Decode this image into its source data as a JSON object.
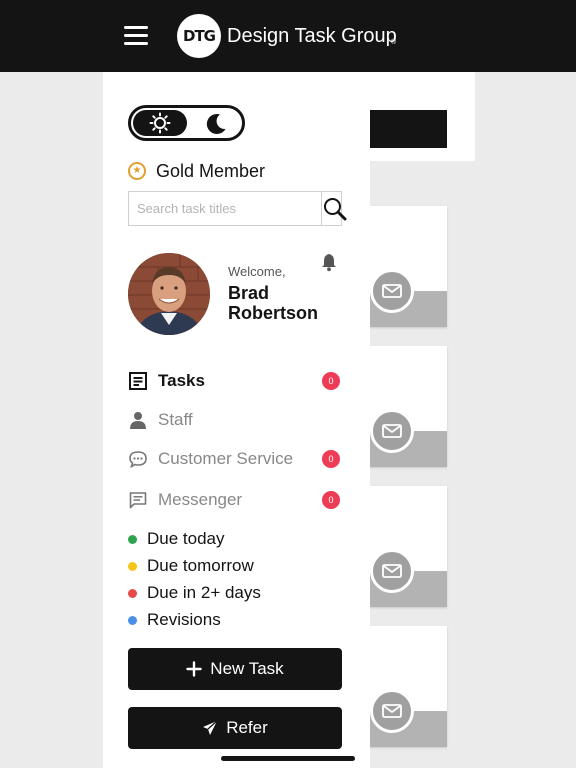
{
  "header": {
    "logo_text": "DTG",
    "brand_name": "Design Task Group",
    "registered_mark": "®"
  },
  "theme_toggle": {
    "selected": "light",
    "options": [
      "sun-icon",
      "moon-icon"
    ]
  },
  "membership": {
    "label": "Gold Member",
    "icon": "star-badge-icon",
    "accent_color": "#e0a030"
  },
  "search": {
    "placeholder": "Search task titles",
    "value": ""
  },
  "user": {
    "greeting": "Welcome,",
    "name": "Brad Robertson"
  },
  "nav": {
    "items": [
      {
        "label": "Tasks",
        "icon": "tasks-icon",
        "badge": "0",
        "active": true
      },
      {
        "label": "Staff",
        "icon": "person-icon",
        "active": false
      },
      {
        "label": "Customer Service",
        "icon": "chat-bubble-icon",
        "badge": "0",
        "active": false
      },
      {
        "label": "Messenger",
        "icon": "message-icon",
        "badge": "0",
        "active": false
      }
    ]
  },
  "legend": {
    "items": [
      {
        "label": "Due today",
        "color": "#2ea44f"
      },
      {
        "label": "Due tomorrow",
        "color": "#f5c518"
      },
      {
        "label": "Due in 2+ days",
        "color": "#e84a4a"
      },
      {
        "label": "Revisions",
        "color": "#4a8fe8"
      }
    ]
  },
  "actions": {
    "new_task": "New Task",
    "refer": "Refer"
  },
  "colors": {
    "header_bg": "#141414",
    "badge": "#ee3c57",
    "button_bg": "#141414"
  }
}
